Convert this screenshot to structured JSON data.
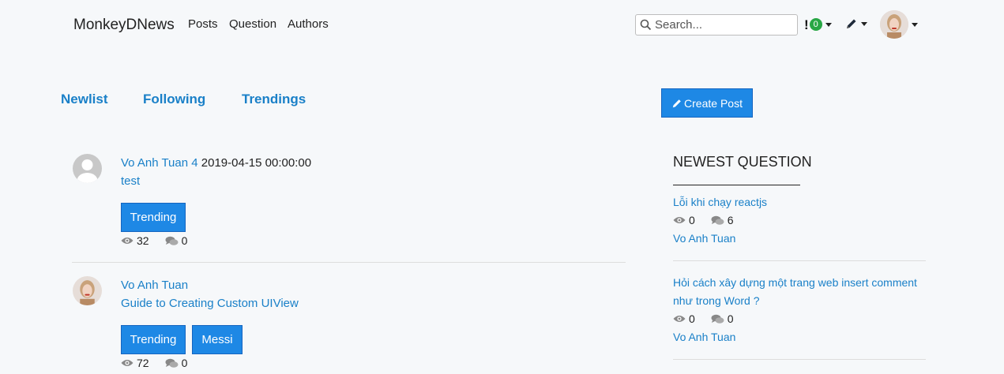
{
  "nav": {
    "brand": "MonkeyDNews",
    "links": [
      "Posts",
      "Question",
      "Authors"
    ],
    "search_placeholder": "Search...",
    "notification_count": "0",
    "notification_symbol": "!"
  },
  "tabs": [
    "Newlist",
    "Following",
    "Trendings"
  ],
  "create_post_label": "Create Post",
  "posts": [
    {
      "author": "Vo Anh Tuan 4",
      "date": "2019-04-15 00:00:00",
      "title": "test",
      "tags": [
        "Trending"
      ],
      "views": "32",
      "comments": "0"
    },
    {
      "author": "Vo Anh Tuan",
      "date": "",
      "title": "Guide to Creating Custom UIView",
      "tags": [
        "Trending",
        "Messi"
      ],
      "views": "72",
      "comments": "0"
    }
  ],
  "sidebar": {
    "title": "NEWEST QUESTION",
    "questions": [
      {
        "title": "Lỗi khi chạy reactjs",
        "views": "0",
        "comments": "6",
        "author": "Vo Anh Tuan"
      },
      {
        "title": "Hỏi cách xây dựng một trang web insert comment như trong Word ?",
        "views": "0",
        "comments": "0",
        "author": "Vo Anh Tuan"
      }
    ]
  },
  "colors": {
    "link": "#1a80c8",
    "button": "#1e88e5",
    "badge": "#28a745"
  }
}
